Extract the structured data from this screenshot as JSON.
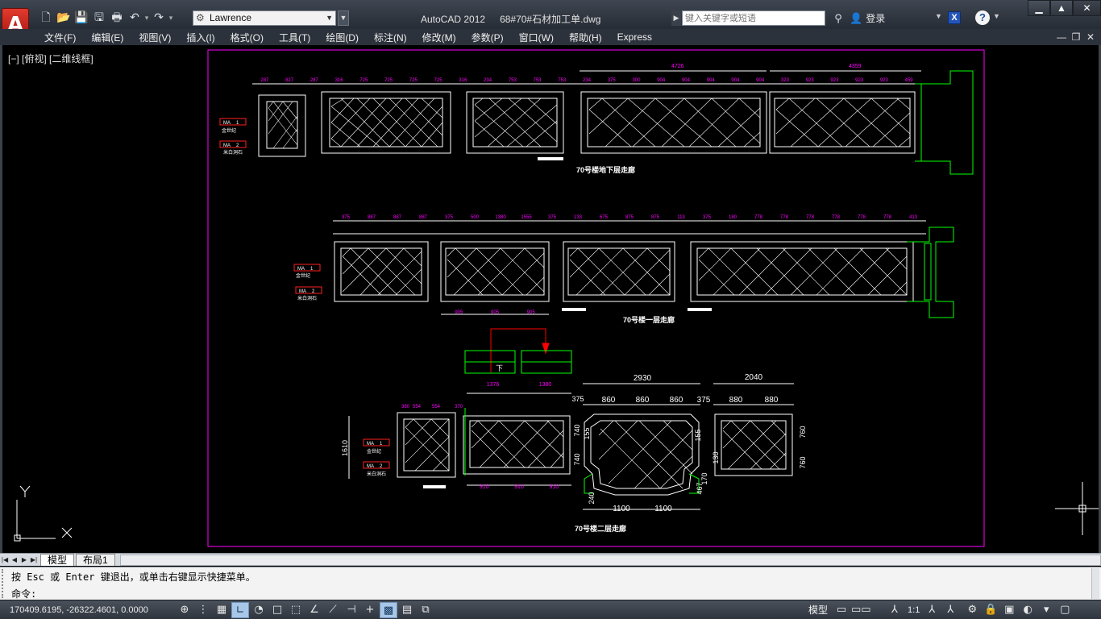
{
  "titlebar": {
    "app_name": "AutoCAD 2012",
    "file_name": "68#70#石材加工单.dwg",
    "workspace": "Lawrence",
    "search_placeholder": "键入关键字或短语",
    "login_label": "登录",
    "app_button_letter": "A",
    "exchange_label": "X",
    "help_label": "?"
  },
  "menubar": {
    "items": [
      "文件(F)",
      "编辑(E)",
      "视图(V)",
      "插入(I)",
      "格式(O)",
      "工具(T)",
      "绘图(D)",
      "标注(N)",
      "修改(M)",
      "参数(P)",
      "窗口(W)",
      "帮助(H)",
      "Express"
    ]
  },
  "viewport": {
    "label": "[−] [俯视] [二维线框]",
    "ucs_x": "X",
    "ucs_y": "Y"
  },
  "drawing": {
    "section_titles": [
      "70号楼地下层走廊",
      "70号楼一层走廊",
      "70号楼二层走廊"
    ],
    "material_codes": [
      "MA",
      "MA"
    ],
    "material_numbers": [
      "1",
      "2"
    ],
    "material_names": [
      "金世纪",
      "米白洞石"
    ],
    "dims_row1_top": [
      "287",
      "827",
      "287",
      "316",
      "725",
      "725",
      "725",
      "725",
      "316",
      "234",
      "753",
      "753",
      "753",
      "234",
      "375",
      "300",
      "904",
      "904",
      "904",
      "904",
      "904",
      "323",
      "923",
      "923",
      "923",
      "923",
      "459"
    ],
    "dims_row1_overall": [
      "4726",
      "4359"
    ],
    "dims_row2_top": [
      "375",
      "887",
      "887",
      "887",
      "375",
      "500",
      "1380",
      "1555",
      "375",
      "133",
      "675",
      "875",
      "875",
      "113",
      "375",
      "180",
      "778",
      "778",
      "778",
      "778",
      "778",
      "778",
      "413"
    ],
    "dims_row2_bottom": [
      "905",
      "905",
      "905"
    ],
    "dims_row3_top": [
      "1376",
      "1380",
      "2930",
      "860",
      "860",
      "860",
      "375",
      "2040",
      "880",
      "880",
      "380",
      "554",
      "554",
      "370"
    ],
    "dims_row3_bottom": [
      "910",
      "910",
      "910",
      "1100",
      "1100"
    ],
    "dims_row3_side": [
      "1610",
      "375",
      "740",
      "740",
      "155",
      "155",
      "760",
      "760",
      "130",
      "467",
      "170",
      "240"
    ],
    "stair_label": "下"
  },
  "tabs": {
    "items": [
      "模型",
      "布局1"
    ]
  },
  "command": {
    "history": "按 Esc 或 Enter 键退出，或单击右键显示快捷菜单。",
    "prompt": "命令:",
    "value": ""
  },
  "statusbar": {
    "coordinates": "170409.6195, -26322.4601, 0.0000",
    "model_label": "模型",
    "annotation_scale": "1:1"
  },
  "colors": {
    "frame": "#ff00ff",
    "lines": "#ffffff",
    "dims": "#ffffff",
    "dim_text": "#ff00ff",
    "green": "#00ff00",
    "red": "#ff0000",
    "cyan": "#00ffff"
  }
}
